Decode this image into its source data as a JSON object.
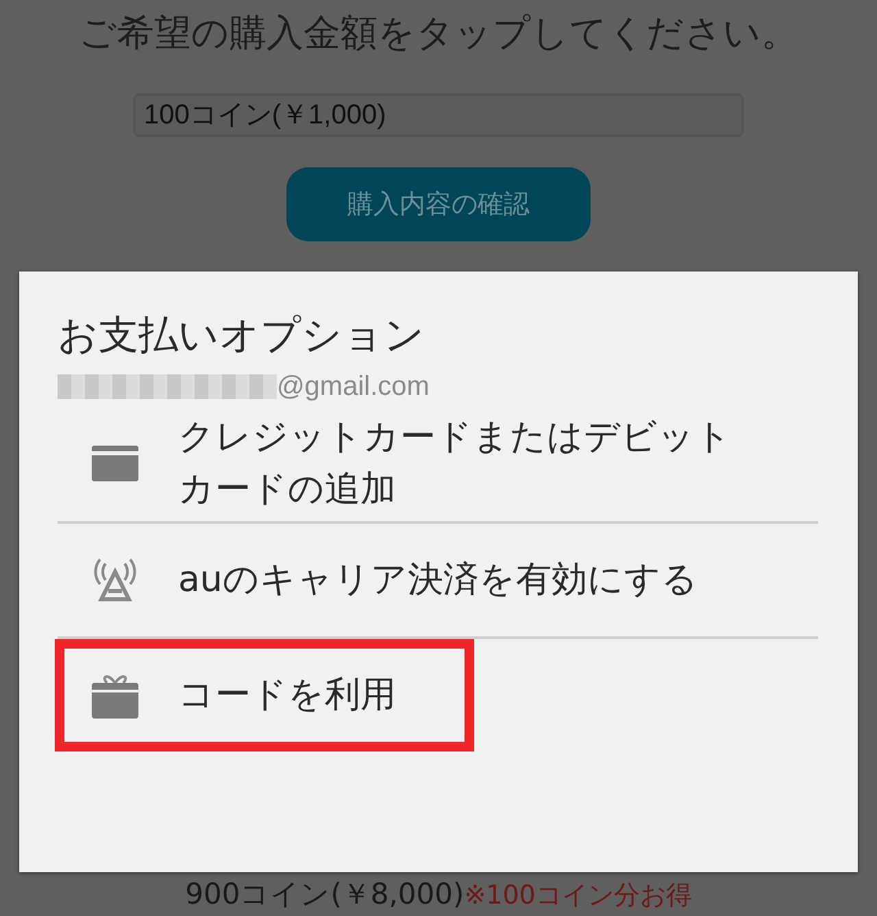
{
  "page": {
    "heading": "ご希望の購入金額をタップしてください。",
    "amount_select": {
      "value": "100コイン(￥1,000)"
    },
    "confirm_button": "購入内容の確認",
    "offer": {
      "label": "900コイン(￥8,000)",
      "bonus": "※100コイン分お得"
    }
  },
  "dialog": {
    "title": "お支払いオプション",
    "account": "@gmail.com",
    "options": [
      {
        "kind": "card",
        "label": "クレジットカードまたはデビットカードの追加",
        "highlighted": false
      },
      {
        "kind": "carrier",
        "label": "auのキャリア決済を有効にする",
        "highlighted": false
      },
      {
        "kind": "gift",
        "label": "コードを利用",
        "highlighted": true
      }
    ]
  }
}
